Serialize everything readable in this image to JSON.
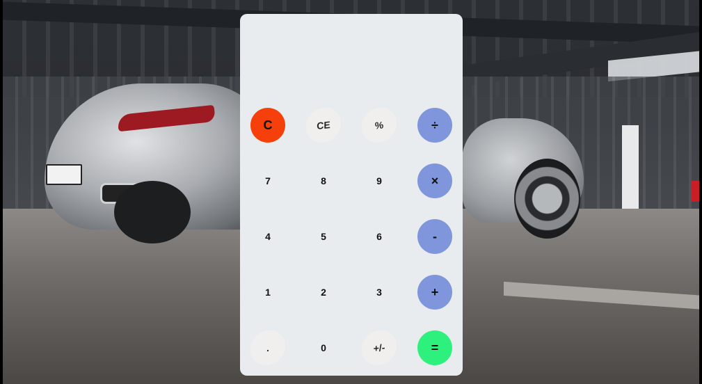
{
  "display": {
    "value": ""
  },
  "keypad": {
    "rows": [
      [
        {
          "label": "C",
          "name": "clear-button"
        },
        {
          "label": "CE",
          "name": "clear-entry-button"
        },
        {
          "label": "%",
          "name": "percent-button"
        },
        {
          "label": "÷",
          "name": "divide-button"
        }
      ],
      [
        {
          "label": "7",
          "name": "digit-7-button"
        },
        {
          "label": "8",
          "name": "digit-8-button"
        },
        {
          "label": "9",
          "name": "digit-9-button"
        },
        {
          "label": "×",
          "name": "multiply-button"
        }
      ],
      [
        {
          "label": "4",
          "name": "digit-4-button"
        },
        {
          "label": "5",
          "name": "digit-5-button"
        },
        {
          "label": "6",
          "name": "digit-6-button"
        },
        {
          "label": "-",
          "name": "subtract-button"
        }
      ],
      [
        {
          "label": "1",
          "name": "digit-1-button"
        },
        {
          "label": "2",
          "name": "digit-2-button"
        },
        {
          "label": "3",
          "name": "digit-3-button"
        },
        {
          "label": "+",
          "name": "add-button"
        }
      ],
      [
        {
          "label": ".",
          "name": "decimal-button"
        },
        {
          "label": "0",
          "name": "digit-0-button"
        },
        {
          "label": "+/-",
          "name": "negate-button"
        },
        {
          "label": "=",
          "name": "equals-button"
        }
      ]
    ]
  },
  "colors": {
    "clear": "#f5400b",
    "operator": "#7f96dc",
    "equals": "#2ef07c",
    "panel": "#e9ecef",
    "key_light": "#f1f0ee"
  }
}
